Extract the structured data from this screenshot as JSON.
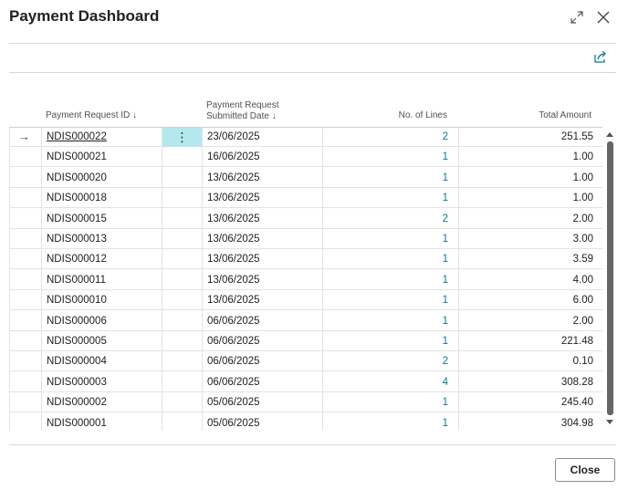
{
  "dialog": {
    "title": "Payment Dashboard",
    "expand_icon": "expand-icon",
    "close_icon": "close-icon",
    "share_icon": "share-icon"
  },
  "table": {
    "columns": {
      "request_id": "Payment Request ID",
      "submitted_date_line1": "Payment Request",
      "submitted_date_line2": "Submitted Date",
      "no_of_lines": "No. of Lines",
      "total_amount": "Total Amount",
      "sort_indicator": "↓"
    },
    "row_pointer": "→",
    "row_menu": "⋮",
    "rows": [
      {
        "id": "NDIS000022",
        "date": "23/06/2025",
        "lines": "2",
        "amount": "251.55"
      },
      {
        "id": "NDIS000021",
        "date": "16/06/2025",
        "lines": "1",
        "amount": "1.00"
      },
      {
        "id": "NDIS000020",
        "date": "13/06/2025",
        "lines": "1",
        "amount": "1.00"
      },
      {
        "id": "NDIS000018",
        "date": "13/06/2025",
        "lines": "1",
        "amount": "1.00"
      },
      {
        "id": "NDIS000015",
        "date": "13/06/2025",
        "lines": "2",
        "amount": "2.00"
      },
      {
        "id": "NDIS000013",
        "date": "13/06/2025",
        "lines": "1",
        "amount": "3.00"
      },
      {
        "id": "NDIS000012",
        "date": "13/06/2025",
        "lines": "1",
        "amount": "3.59"
      },
      {
        "id": "NDIS000011",
        "date": "13/06/2025",
        "lines": "1",
        "amount": "4.00"
      },
      {
        "id": "NDIS000010",
        "date": "13/06/2025",
        "lines": "1",
        "amount": "6.00"
      },
      {
        "id": "NDIS000006",
        "date": "06/06/2025",
        "lines": "1",
        "amount": "2.00"
      },
      {
        "id": "NDIS000005",
        "date": "06/06/2025",
        "lines": "1",
        "amount": "221.48"
      },
      {
        "id": "NDIS000004",
        "date": "06/06/2025",
        "lines": "2",
        "amount": "0.10"
      },
      {
        "id": "NDIS000003",
        "date": "06/06/2025",
        "lines": "4",
        "amount": "308.28"
      },
      {
        "id": "NDIS000002",
        "date": "05/06/2025",
        "lines": "1",
        "amount": "245.40"
      },
      {
        "id": "NDIS000001",
        "date": "05/06/2025",
        "lines": "1",
        "amount": "304.98"
      }
    ]
  },
  "footer": {
    "close_label": "Close"
  },
  "colors": {
    "accent": "#007d8a",
    "selected_cell": "#b5e7ef"
  }
}
